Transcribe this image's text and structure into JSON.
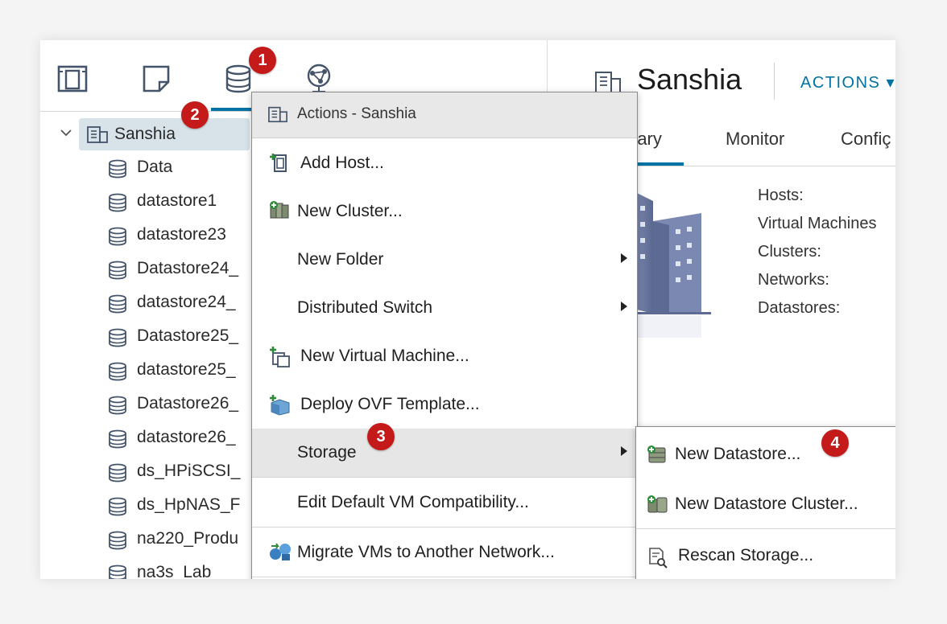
{
  "colors": {
    "accent": "#0072a3",
    "badge": "#c41a1a",
    "selected_row": "#d8e3e9",
    "menu_highlight": "#e6e6e6"
  },
  "nav_icons": [
    "hosts-clusters-icon",
    "vms-templates-icon",
    "storage-icon",
    "networking-icon"
  ],
  "tree": {
    "root_label": "Sanshia",
    "datastores": [
      "Data",
      "datastore1",
      "datastore23",
      "Datastore24_",
      "datastore24_",
      "Datastore25_",
      "datastore25_",
      "Datastore26_",
      "datastore26_",
      "ds_HPiSCSI_",
      "ds_HpNAS_F",
      "na220_Produ",
      "na3s_Lab"
    ]
  },
  "header": {
    "title": "Sanshia",
    "actions_label": "ACTIONS ▾"
  },
  "tabs": [
    "mary",
    "Monitor",
    "Confiç"
  ],
  "summary": {
    "stats": [
      "Hosts:",
      "Virtual Machines",
      "Clusters:",
      "Networks:",
      "Datastores:"
    ]
  },
  "context_menu": {
    "title": "Actions - Sanshia",
    "items": [
      {
        "label": "Add Host...",
        "icon": "add-host-icon"
      },
      {
        "label": "New Cluster...",
        "icon": "new-cluster-icon"
      },
      {
        "label": "New Folder",
        "icon": ""
      },
      {
        "label": "Distributed Switch",
        "icon": ""
      },
      {
        "label": "New Virtual Machine...",
        "icon": "new-vm-icon"
      },
      {
        "label": "Deploy OVF Template...",
        "icon": "deploy-ovf-icon"
      },
      {
        "label": "Storage",
        "icon": ""
      },
      {
        "label": "Edit Default VM Compatibility...",
        "icon": ""
      },
      {
        "label": "Migrate VMs to Another Network...",
        "icon": "migrate-network-icon"
      }
    ]
  },
  "storage_submenu": {
    "items": [
      {
        "label": "New Datastore...",
        "icon": "new-datastore-icon"
      },
      {
        "label": "New Datastore Cluster...",
        "icon": "new-datastore-cluster-icon"
      },
      {
        "label": "Rescan Storage...",
        "icon": "rescan-storage-icon"
      }
    ]
  },
  "callouts": [
    "1",
    "2",
    "3",
    "4"
  ]
}
